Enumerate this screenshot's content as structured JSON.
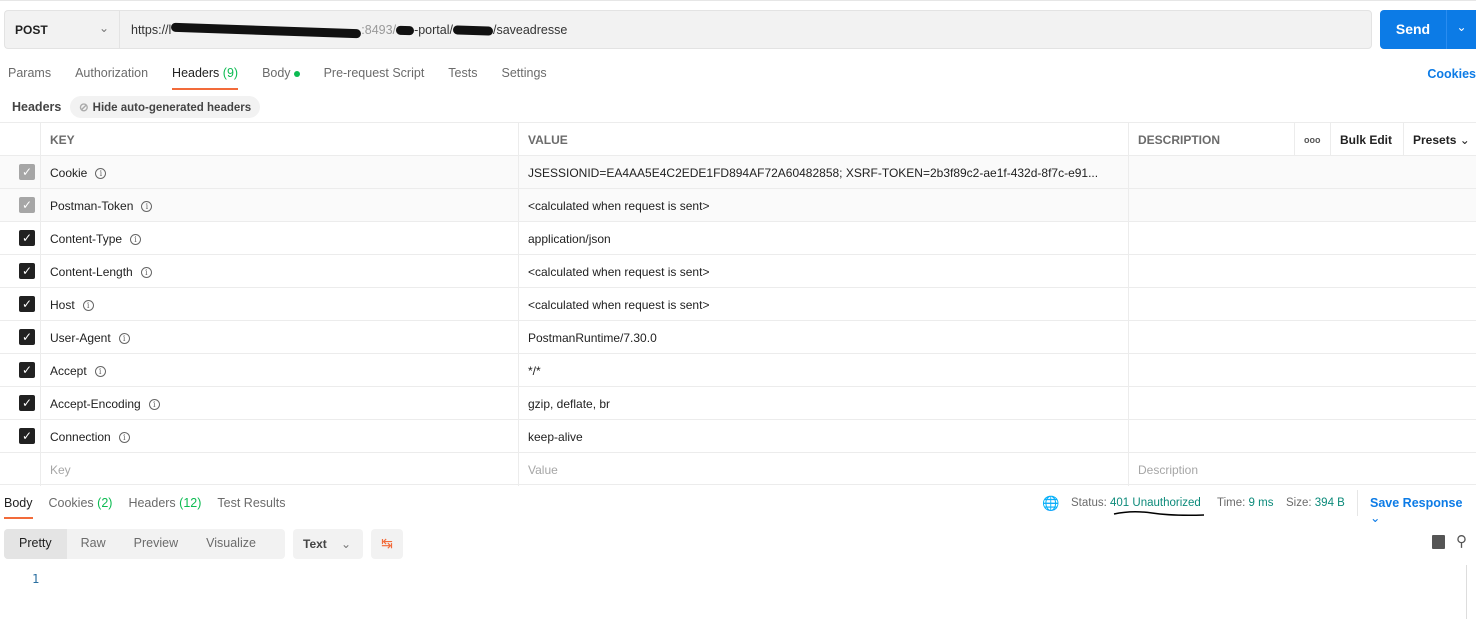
{
  "request": {
    "method": "POST",
    "url_prefix": "https://l",
    "url_mid1": ":8493/",
    "url_mid2": "-portal/",
    "url_suffix": "/saveadresse",
    "send_label": "Send"
  },
  "tabs": [
    {
      "label": "Params"
    },
    {
      "label": "Authorization"
    },
    {
      "label": "Headers",
      "count": "(9)",
      "active": true
    },
    {
      "label": "Body",
      "dot": true
    },
    {
      "label": "Pre-request Script"
    },
    {
      "label": "Tests"
    },
    {
      "label": "Settings"
    }
  ],
  "cookies_link": "Cookies",
  "headers_section": {
    "label": "Headers",
    "hide_auto": "Hide auto-generated headers"
  },
  "table": {
    "columns": {
      "key": "KEY",
      "value": "VALUE",
      "description": "DESCRIPTION",
      "more": "ooo",
      "bulk_edit": "Bulk Edit",
      "presets": "Presets"
    },
    "rows": [
      {
        "key": "Cookie",
        "value": "JSESSIONID=EA4AA5E4C2EDE1FD894AF72A60482858; XSRF-TOKEN=2b3f89c2-ae1f-432d-8f7c-e91...",
        "checked": true,
        "auto": true
      },
      {
        "key": "Postman-Token",
        "value": "<calculated when request is sent>",
        "checked": true,
        "auto": true
      },
      {
        "key": "Content-Type",
        "value": "application/json",
        "checked": true
      },
      {
        "key": "Content-Length",
        "value": "<calculated when request is sent>",
        "checked": true
      },
      {
        "key": "Host",
        "value": "<calculated when request is sent>",
        "checked": true
      },
      {
        "key": "User-Agent",
        "value": "PostmanRuntime/7.30.0",
        "checked": true
      },
      {
        "key": "Accept",
        "value": "*/*",
        "checked": true
      },
      {
        "key": "Accept-Encoding",
        "value": "gzip, deflate, br",
        "checked": true
      },
      {
        "key": "Connection",
        "value": "keep-alive",
        "checked": true
      }
    ],
    "placeholders": {
      "key": "Key",
      "value": "Value",
      "description": "Description"
    }
  },
  "response": {
    "tabs": [
      {
        "label": "Body",
        "active": true
      },
      {
        "label": "Cookies",
        "count": "(2)"
      },
      {
        "label": "Headers",
        "count": "(12)"
      },
      {
        "label": "Test Results"
      }
    ],
    "status_label": "Status:",
    "status_value": "401 Unauthorized",
    "time_label": "Time:",
    "time_value": "9 ms",
    "size_label": "Size:",
    "size_value": "394 B",
    "save_response": "Save Response",
    "views": [
      "Pretty",
      "Raw",
      "Preview",
      "Visualize"
    ],
    "format": "Text",
    "line_number": "1"
  },
  "colors": {
    "accent": "#0c7be6",
    "tab_underline": "#f26b3a",
    "count_green": "#0cbb52",
    "status": "#0c8a7a"
  }
}
